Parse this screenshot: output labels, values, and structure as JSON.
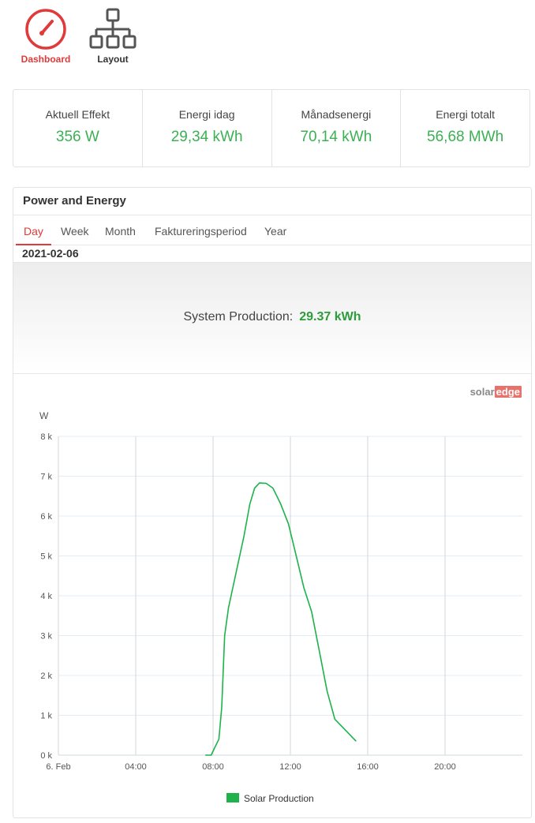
{
  "nav": {
    "dashboard_label": "Dashboard",
    "layout_label": "Layout"
  },
  "stats": [
    {
      "label": "Aktuell Effekt",
      "value": "356 W"
    },
    {
      "label": "Energi idag",
      "value": "29,34 kWh"
    },
    {
      "label": "Månadsenergi",
      "value": "70,14 kWh"
    },
    {
      "label": "Energi totalt",
      "value": "56,68 MWh"
    }
  ],
  "panel": {
    "title": "Power and Energy",
    "tabs": [
      "Day",
      "Week",
      "Month",
      "Faktureringsperiod",
      "Year"
    ],
    "active_tab": "Day",
    "date": "2021-02-06",
    "production_label": "System Production:",
    "production_value": "29.37 kWh",
    "logo_text_1": "solar",
    "logo_text_2": "edge"
  },
  "colors": {
    "accent_red": "#e03a3a",
    "value_green": "#3cb054",
    "series_green": "#1db34a"
  },
  "chart_data": {
    "type": "line",
    "ylabel": "W",
    "ylim": [
      0,
      8000
    ],
    "yticks": [
      "0 k",
      "1 k",
      "2 k",
      "3 k",
      "4 k",
      "5 k",
      "6 k",
      "7 k",
      "8 k"
    ],
    "xlim_hours": [
      0,
      24
    ],
    "xticks": [
      {
        "hour": 0,
        "label": "6. Feb"
      },
      {
        "hour": 4,
        "label": "04:00"
      },
      {
        "hour": 8,
        "label": "08:00"
      },
      {
        "hour": 12,
        "label": "12:00"
      },
      {
        "hour": 16,
        "label": "16:00"
      },
      {
        "hour": 20,
        "label": "20:00"
      }
    ],
    "grid": true,
    "legend_position": "bottom-center",
    "series": [
      {
        "name": "Solar Production",
        "points": [
          [
            7.6,
            0
          ],
          [
            7.9,
            0
          ],
          [
            8.1,
            200
          ],
          [
            8.3,
            400
          ],
          [
            8.45,
            1200
          ],
          [
            8.6,
            3000
          ],
          [
            8.8,
            3700
          ],
          [
            9.2,
            4600
          ],
          [
            9.6,
            5500
          ],
          [
            9.9,
            6300
          ],
          [
            10.15,
            6700
          ],
          [
            10.4,
            6830
          ],
          [
            10.75,
            6820
          ],
          [
            11.1,
            6700
          ],
          [
            11.5,
            6300
          ],
          [
            11.9,
            5800
          ],
          [
            12.3,
            5000
          ],
          [
            12.7,
            4200
          ],
          [
            13.1,
            3600
          ],
          [
            13.5,
            2600
          ],
          [
            13.9,
            1600
          ],
          [
            14.3,
            900
          ],
          [
            14.6,
            750
          ],
          [
            14.9,
            600
          ],
          [
            15.2,
            450
          ],
          [
            15.4,
            350
          ]
        ]
      }
    ]
  }
}
